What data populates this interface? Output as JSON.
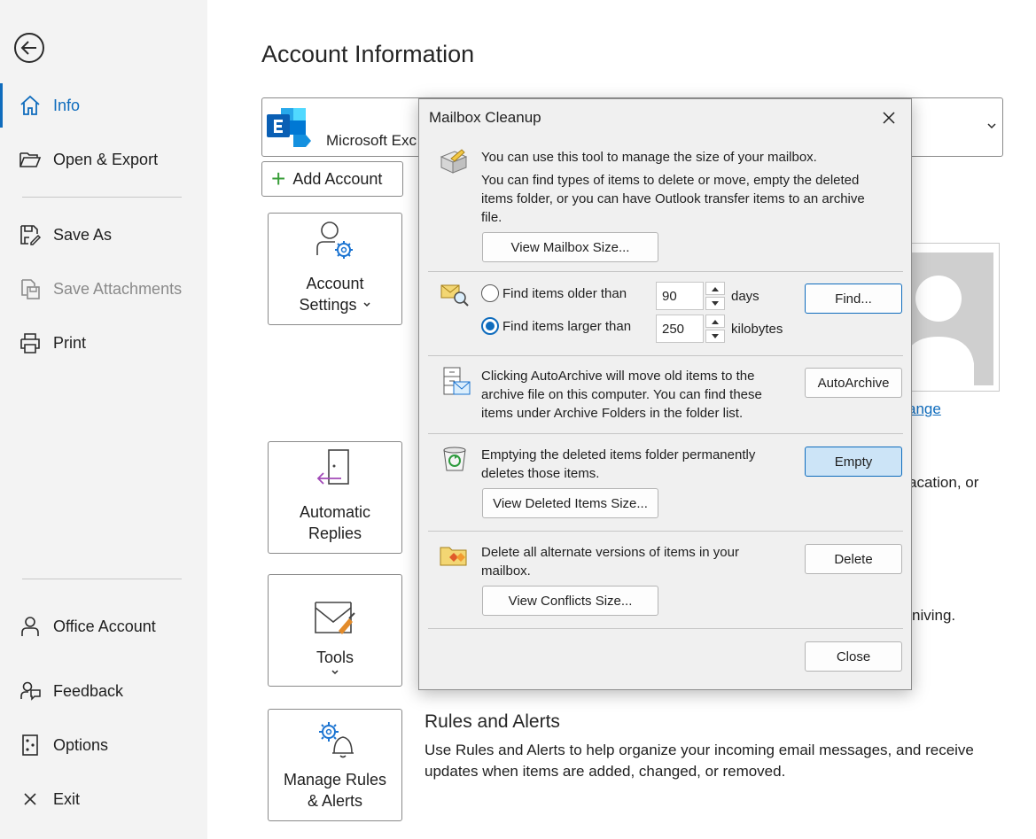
{
  "nav": {
    "back_label": "",
    "items": [
      {
        "label": "Info"
      },
      {
        "label": "Open & Export"
      },
      {
        "label": "Save As"
      },
      {
        "label": "Save Attachments"
      },
      {
        "label": "Print"
      },
      {
        "label": "Office Account"
      },
      {
        "label": "Feedback"
      },
      {
        "label": "Options"
      },
      {
        "label": "Exit"
      }
    ]
  },
  "main": {
    "title": "Account Information",
    "account_name": "Microsoft Exc",
    "add_account": "Add Account",
    "account_settings": [
      "Account",
      "Settings"
    ],
    "automatic_replies": [
      "Automatic",
      "Replies"
    ],
    "tools": "Tools",
    "manage_rules": [
      "Manage Rules",
      "& Alerts"
    ],
    "change_link": "ange",
    "bg_vacation": "acation, or",
    "bg_archiving": "niving.",
    "rules_title": "Rules and Alerts",
    "rules_desc": "Use Rules and Alerts to help organize your incoming email messages, and receive updates when items are added, changed, or removed."
  },
  "dialog": {
    "title": "Mailbox Cleanup",
    "intro1": "You can use this tool to manage the size of your mailbox.",
    "intro2": "You can find types of items to delete or move, empty the deleted items folder, or you can have Outlook transfer items to an archive file.",
    "view_mailbox_size": "View Mailbox Size...",
    "find_older_label": "Find items older than",
    "find_older_value": "90",
    "find_older_unit": "days",
    "find_larger_label": "Find items larger than",
    "find_larger_value": "250",
    "find_larger_unit": "kilobytes",
    "find_button": "Find...",
    "autoarchive_text": "Clicking AutoArchive will move old items to the archive file on this computer. You can find these items under Archive Folders in the folder list.",
    "autoarchive_button": "AutoArchive",
    "empty_text": "Emptying the deleted items folder permanently deletes those items.",
    "empty_button": "Empty",
    "view_deleted_size": "View Deleted Items Size...",
    "conflicts_text": "Delete all alternate versions of items in your mailbox.",
    "delete_button": "Delete",
    "view_conflicts_size": "View Conflicts Size...",
    "close_button": "Close"
  },
  "colors": {
    "accent": "#0f6cbd",
    "nav_bg": "#f3f3f3",
    "dialog_bg": "#f0f0f0"
  }
}
